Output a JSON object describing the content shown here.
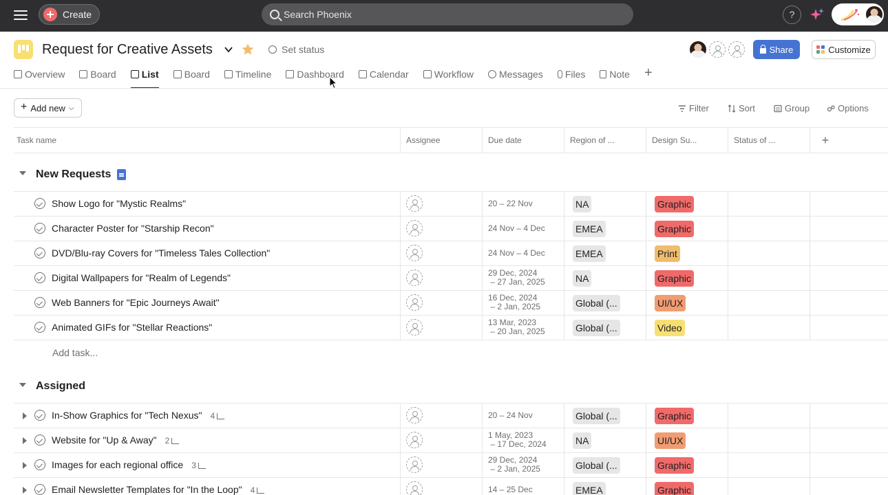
{
  "topbar": {
    "create_label": "Create",
    "search_placeholder": "Search Phoenix",
    "help_label": "?"
  },
  "project": {
    "title": "Request for Creative Assets",
    "set_status_label": "Set status",
    "share_label": "Share",
    "customize_label": "Customize",
    "icon_color": "#f8df72"
  },
  "tabs": [
    {
      "label": "Overview",
      "icon": "clipboard-icon"
    },
    {
      "label": "Board",
      "icon": "board-icon"
    },
    {
      "label": "List",
      "icon": "list-icon",
      "active": true
    },
    {
      "label": "Board",
      "icon": "board-icon"
    },
    {
      "label": "Timeline",
      "icon": "timeline-icon"
    },
    {
      "label": "Dashboard",
      "icon": "dashboard-icon"
    },
    {
      "label": "Calendar",
      "icon": "calendar-icon"
    },
    {
      "label": "Workflow",
      "icon": "workflow-icon"
    },
    {
      "label": "Messages",
      "icon": "message-icon"
    },
    {
      "label": "Files",
      "icon": "paperclip-icon"
    },
    {
      "label": "Note",
      "icon": "note-icon"
    }
  ],
  "toolbar": {
    "add_new_label": "Add new",
    "filter_label": "Filter",
    "sort_label": "Sort",
    "group_label": "Group",
    "options_label": "Options"
  },
  "columns": [
    "Task name",
    "Assignee",
    "Due date",
    "Region of ...",
    "Design Su...",
    "Status of ..."
  ],
  "tag_colors": {
    "Graphic": "#f06a6a",
    "Print": "#f1bd6c",
    "UI/UX": "#f19c72",
    "Video": "#f8df72"
  },
  "sections": [
    {
      "title": "New Requests",
      "add_task_label": "Add task...",
      "tasks": [
        {
          "name": "Show Logo for \"Mystic Realms\"",
          "due": "20 – 22 Nov",
          "region": "NA",
          "design": "Graphic"
        },
        {
          "name": "Character Poster for \"Starship Recon\"",
          "due": "24 Nov – 4 Dec",
          "region": "EMEA",
          "design": "Graphic"
        },
        {
          "name": "DVD/Blu-ray Covers for \"Timeless Tales Collection\"",
          "due": "24 Nov – 4 Dec",
          "region": "EMEA",
          "design": "Print"
        },
        {
          "name": "Digital Wallpapers for \"Realm of Legends\"",
          "due": "29 Dec, 2024\n – 27 Jan, 2025",
          "region": "NA",
          "design": "Graphic"
        },
        {
          "name": "Web Banners for \"Epic Journeys Await\"",
          "due": "16 Dec, 2024\n – 2 Jan, 2025",
          "region": "Global (...",
          "design": "UI/UX"
        },
        {
          "name": "Animated GIFs for \"Stellar Reactions\"",
          "due": "13 Mar, 2023\n – 20 Jan, 2025",
          "region": "Global (...",
          "design": "Video"
        }
      ]
    },
    {
      "title": "Assigned",
      "tasks": [
        {
          "name": "In-Show Graphics for \"Tech Nexus\"",
          "subtasks": "4",
          "due": "20 – 24 Nov",
          "region": "Global (...",
          "design": "Graphic"
        },
        {
          "name": "Website for \"Up & Away\"",
          "subtasks": "2",
          "due": "1 May, 2023\n – 17 Dec, 2024",
          "region": "NA",
          "design": "UI/UX"
        },
        {
          "name": "Images for each regional office",
          "subtasks": "3",
          "due": "29 Dec, 2024\n – 2 Jan, 2025",
          "region": "Global (...",
          "design": "Graphic"
        },
        {
          "name": "Email Newsletter Templates for \"In the Loop\"",
          "subtasks": "4",
          "due": "14 – 25 Dec",
          "region": "EMEA",
          "design": "Graphic"
        }
      ]
    }
  ]
}
